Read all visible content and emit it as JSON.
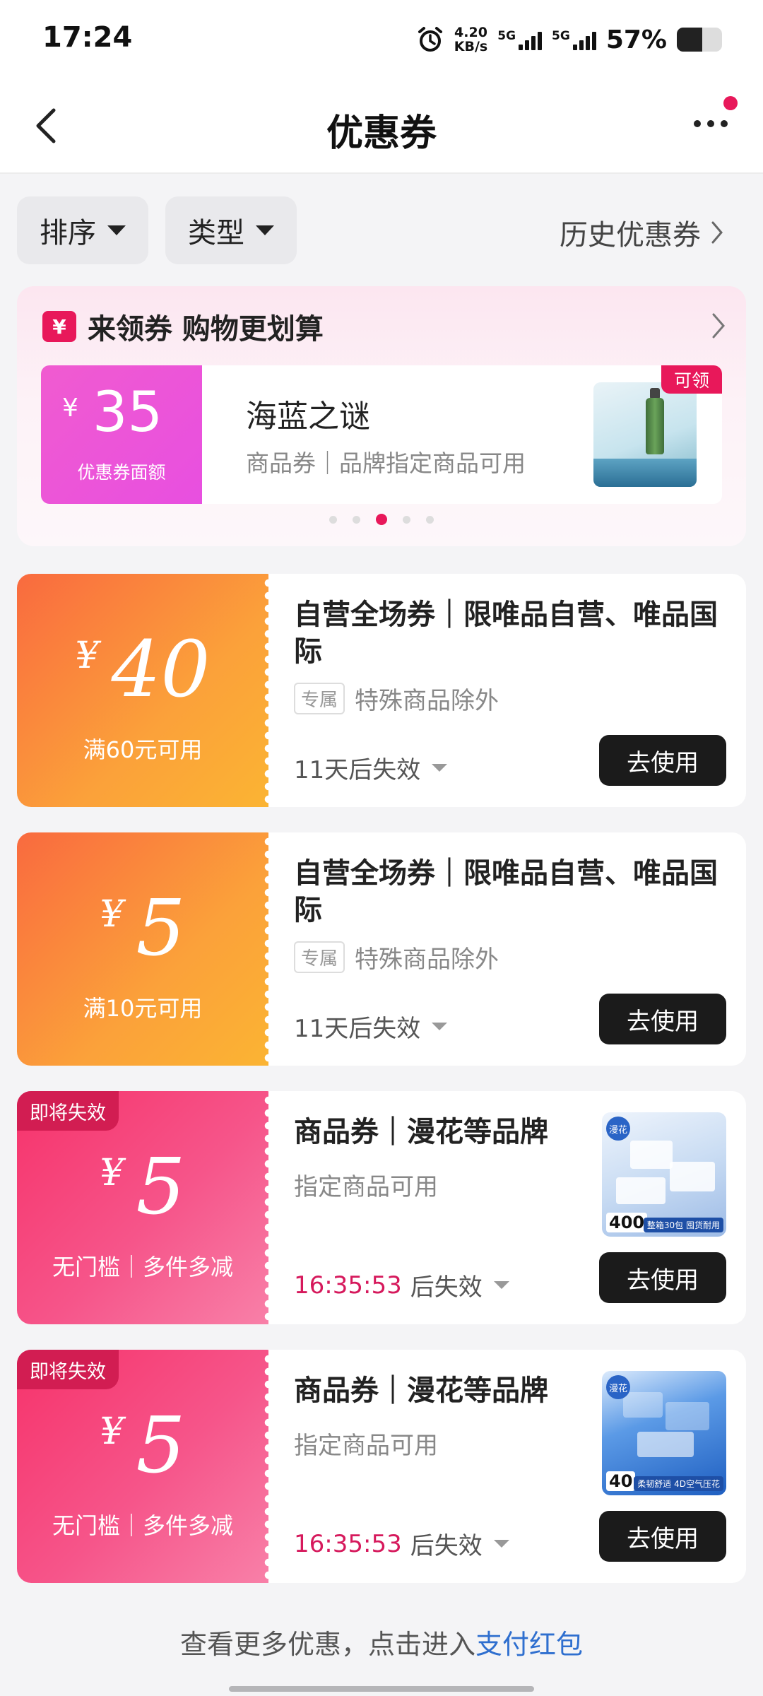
{
  "status": {
    "time": "17:24",
    "speed_value": "4.20",
    "speed_unit": "KB/s",
    "net1": "5G",
    "net2": "5G",
    "battery_pct": "57%",
    "battery_level": 0.57,
    "alarm_icon": "alarm-clock-icon"
  },
  "nav": {
    "title": "优惠券",
    "back_icon": "chevron-left-icon",
    "more_icon": "more-dots-icon"
  },
  "filters": {
    "sort_label": "排序",
    "type_label": "类型",
    "history_label": "历史优惠券"
  },
  "promo": {
    "heading": "来领券 购物更划算",
    "badge_symbol": "¥",
    "card": {
      "currency": "¥",
      "amount": "35",
      "amount_label": "优惠券面额",
      "name": "海蓝之谜",
      "desc": "商品券｜品牌指定商品可用",
      "claim_label": "可领"
    },
    "carousel_count": 5,
    "carousel_active": 3
  },
  "coupons": [
    {
      "currency": "¥",
      "amount": "40",
      "condition": "满60元可用",
      "title": "自营全场券｜限唯品自营、唯品国际",
      "tag": "专属",
      "meta": "特殊商品除外",
      "expiry_highlight": "",
      "expiry": "11天后失效",
      "use_label": "去使用",
      "expiring_badge": ""
    },
    {
      "currency": "¥",
      "amount": "5",
      "condition": "满10元可用",
      "title": "自营全场券｜限唯品自营、唯品国际",
      "tag": "专属",
      "meta": "特殊商品除外",
      "expiry_highlight": "",
      "expiry": "11天后失效",
      "use_label": "去使用",
      "expiring_badge": ""
    },
    {
      "currency": "¥",
      "amount": "5",
      "condition": "无门槛｜多件多减",
      "title": "商品券｜漫花等品牌",
      "tag": "",
      "meta": "指定商品可用",
      "expiry_highlight": "16:35:53",
      "expiry": "后失效",
      "use_label": "去使用",
      "expiring_badge": "即将失效",
      "pic_brand": "漫花",
      "pic_count": "400",
      "pic_note": "整箱30包 囤货耐用"
    },
    {
      "currency": "¥",
      "amount": "5",
      "condition": "无门槛｜多件多减",
      "title": "商品券｜漫花等品牌",
      "tag": "",
      "meta": "指定商品可用",
      "expiry_highlight": "16:35:53",
      "expiry": "后失效",
      "use_label": "去使用",
      "expiring_badge": "即将失效",
      "pic_brand": "漫花",
      "pic_count": "40",
      "pic_note": "柔韧舒适 4D空气压花"
    }
  ],
  "footer": {
    "text": "查看更多优惠，点击进入",
    "link": "支付红包"
  },
  "colors": {
    "accent": "#e8185a",
    "button": "#1b1b1b",
    "link": "#2f6fcf"
  }
}
